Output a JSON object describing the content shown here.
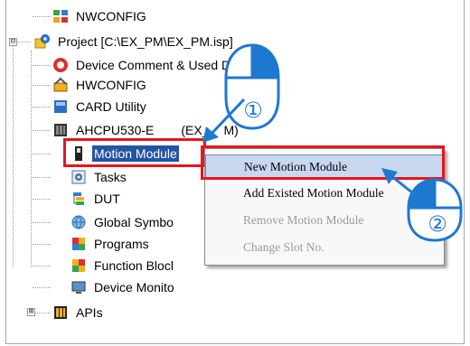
{
  "tree": {
    "items": [
      {
        "label": "NWCONFIG",
        "icon": "nwconfig-icon"
      },
      {
        "label": "Project [C:\\EX_PM\\EX_PM.isp]",
        "icon": "project-gear-icon"
      },
      {
        "label": "Device Comment & Used Device",
        "icon": "device-comment-icon"
      },
      {
        "label": "HWCONFIG",
        "icon": "hwconfig-icon"
      },
      {
        "label": "CARD Utility",
        "icon": "card-utility-icon"
      },
      {
        "label": "AHCPU530-E",
        "label2": "(EX_",
        "label3": "M)",
        "icon": "cpu-module-icon"
      },
      {
        "label": "Motion Module",
        "icon": "motion-module-icon"
      },
      {
        "label": "Tasks",
        "icon": "tasks-icon"
      },
      {
        "label": "DUT",
        "icon": "dut-icon"
      },
      {
        "label": "Global Symbo",
        "icon": "global-symbol-icon"
      },
      {
        "label": "Programs",
        "icon": "programs-icon"
      },
      {
        "label": "Function Blocl",
        "icon": "function-block-icon"
      },
      {
        "label": "Device Monito",
        "icon": "device-monitor-icon"
      },
      {
        "label": "APIs",
        "icon": "apis-icon"
      }
    ],
    "expanders": [
      "⊟",
      "⊞"
    ]
  },
  "context_menu": {
    "items": [
      {
        "label": "New Motion Module",
        "enabled": true,
        "hover": true
      },
      {
        "label": "Add Existed Motion Module",
        "enabled": true
      },
      {
        "label": "Remove Motion Module",
        "enabled": false
      },
      {
        "label": "Change Slot No.",
        "enabled": false
      }
    ]
  },
  "callouts": [
    {
      "number": "①",
      "meaning": "right-click mouse icon"
    },
    {
      "number": "②",
      "meaning": "left-click mouse icon"
    }
  ],
  "colors": {
    "selection": "#2454a4",
    "highlight": "#e8141e",
    "menu_hover": "#c8d8f0",
    "callout_blue": "#1e78d0",
    "arrow_blue": "#1e78d0"
  }
}
